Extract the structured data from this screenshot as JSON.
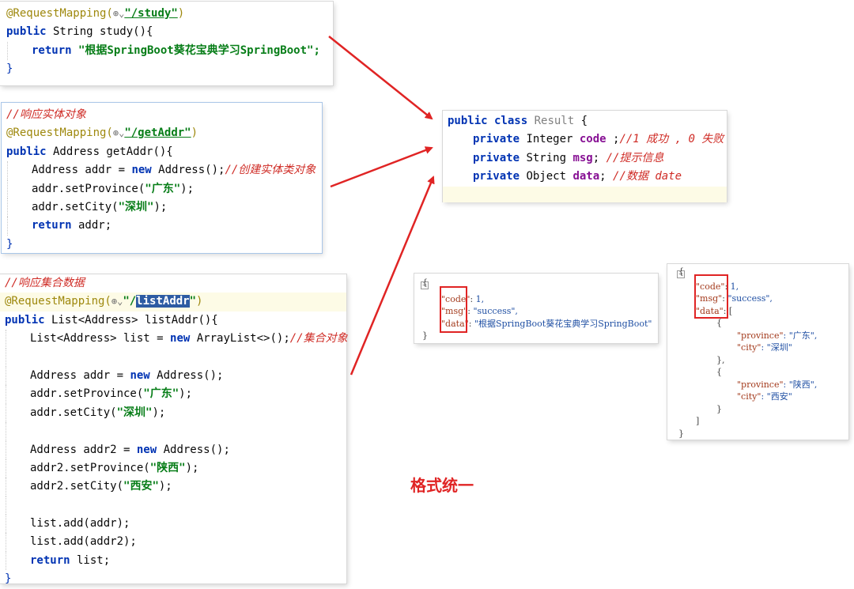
{
  "study_snippet": {
    "annotation": "@RequestMapping(",
    "path": "\"/study\"",
    "close": ")",
    "signature_kw": "public",
    "signature_rest": " String study(){",
    "return_kw": "return",
    "return_value": " \"根据SpringBoot葵花宝典学习SpringBoot\";",
    "end": "}"
  },
  "getaddr_snippet": {
    "comment": "//响应实体对象",
    "annotation": "@RequestMapping(",
    "path": "\"/getAddr\"",
    "close": ")",
    "signature_kw": "public",
    "signature_rest": " Address getAddr(){",
    "line_new_pre": "Address addr = ",
    "new_kw": "new",
    "line_new_post": " Address();",
    "line_new_comment": "//创建实体类对象",
    "set_province_pre": "addr.setProvince(",
    "set_province_val": "\"广东\"",
    "set_city_pre": "addr.setCity(",
    "set_city_val": "\"深圳\"",
    "close_paren_semi": ");",
    "return_kw": "return",
    "return_rest": " addr;",
    "end": "}"
  },
  "listaddr_snippet": {
    "comment": "//响应集合数据",
    "annotation": "@RequestMapping(",
    "path_q": "\"/",
    "path_sel": "listAddr",
    "path_end": "\"",
    "close": ")",
    "signature_kw": "public",
    "signature_rest": " List<Address> listAddr(){",
    "list_pre": "List<Address> list = ",
    "new_kw": "new",
    "list_post": " ArrayList<>();",
    "list_comment": "//集合对象",
    "addr_pre": "Address addr = ",
    "addr_post": " Address();",
    "addr_set_province": "addr.setProvince(",
    "addr_province_val": "\"广东\"",
    "addr_set_city": "addr.setCity(",
    "addr_city_val": "\"深圳\"",
    "addr2_pre": "Address addr2 = ",
    "addr2_post": " Address();",
    "addr2_set_province": "addr2.setProvince(",
    "addr2_province_val": "\"陕西\"",
    "addr2_set_city": "addr2.setCity(",
    "addr2_city_val": "\"西安\"",
    "close_paren_semi": ");",
    "add1": "list.add(addr);",
    "add2": "list.add(addr2);",
    "return_kw": "return",
    "return_rest": " list;",
    "end": "}"
  },
  "result_class": {
    "kw1": "public class",
    "class_name": " Result",
    "brace": " {",
    "private_kw": "private",
    "line1_type": " Integer ",
    "line1_field": "code",
    "line1_rest": " ;",
    "line1_comment": "//1 成功 , 0 失败",
    "line2_type": " String ",
    "line2_field": "msg",
    "line2_rest": "; ",
    "line2_comment": "//提示信息",
    "line3_type": " Object ",
    "line3_field": "data",
    "line3_rest": "; ",
    "line3_comment": "//数据 date"
  },
  "json_small": {
    "open": "{",
    "code_key": "\"code\"",
    "code_sep": ": ",
    "code_val": "1,",
    "msg_key": "\"msg\"",
    "msg_sep": ": ",
    "msg_val": "\"success\",",
    "data_key": "\"data\"",
    "data_sep": ": ",
    "data_val": "\"根据SpringBoot葵花宝典学习SpringBoot\"",
    "close": "}"
  },
  "json_large": {
    "open": "{",
    "code_key": "\"code\"",
    "code_sep": ": ",
    "code_val": "1,",
    "msg_key": "\"msg\"",
    "msg_sep": ": ",
    "msg_val": "\"success\",",
    "data_key": "\"data\"",
    "data_sep": ": ",
    "data_val": "[",
    "obj_open": "{",
    "p1_key": "\"province\"",
    "p1_val": ": \"广东\",",
    "c1_key": "\"city\"",
    "c1_val": ": \"深圳\"",
    "obj_close_comma": "},",
    "p2_key": "\"province\"",
    "p2_val": ": \"陕西\",",
    "c2_key": "\"city\"",
    "c2_val": ": \"西安\"",
    "obj_close": "}",
    "arr_close": "]",
    "close": "}"
  },
  "caption": "格式统一",
  "colors": {
    "arrow": "#e02424",
    "keyword": "#0033b3",
    "string": "#067d17",
    "annotation": "#9e880d",
    "comment": "#cf2b25"
  }
}
